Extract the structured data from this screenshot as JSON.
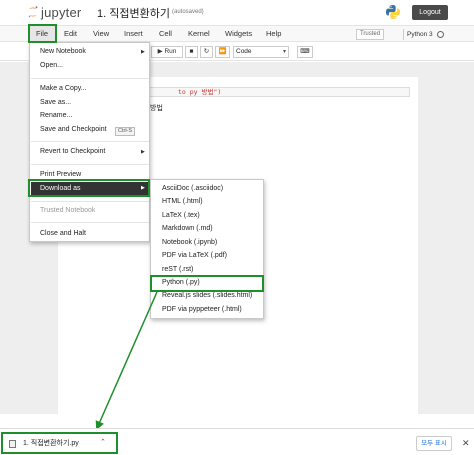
{
  "header": {
    "logo_text": "jupyter",
    "notebook_title": "1. 직접변환하기",
    "autosave_status": "(autosaved)",
    "logout_label": "Logout",
    "python_logo_icon": "python-logo-icon"
  },
  "menubar": {
    "items": [
      "File",
      "Edit",
      "View",
      "Insert",
      "Cell",
      "Kernel",
      "Widgets",
      "Help"
    ],
    "trusted": "Trusted",
    "kernel": "Python 3"
  },
  "toolbar": {
    "run_label": "Run",
    "cell_type": "Code"
  },
  "cell": {
    "input_text": "to py 방법\")",
    "output_text": "방법"
  },
  "file_menu": {
    "new_notebook": "New Notebook",
    "open": "Open...",
    "make_copy": "Make a Copy...",
    "save_as": "Save as...",
    "rename": "Rename...",
    "save_checkpoint": "Save and Checkpoint",
    "save_shortcut": "Ctrl-S",
    "revert": "Revert to Checkpoint",
    "print_preview": "Print Preview",
    "download_as": "Download as",
    "trusted_notebook": "Trusted Notebook",
    "close_halt": "Close and Halt"
  },
  "download_menu": {
    "items": [
      "AsciiDoc (.asciidoc)",
      "HTML (.html)",
      "LaTeX (.tex)",
      "Markdown (.md)",
      "Notebook (.ipynb)",
      "PDF via LaTeX (.pdf)",
      "reST (.rst)",
      "Python (.py)",
      "Reveal.js slides (.slides.html)",
      "PDF via pyppeteer (.html)"
    ],
    "highlighted_index": 7
  },
  "download_shelf": {
    "file_name": "1. 직접변환하기.py",
    "show_all": "모두 표시",
    "close_icon": "close-icon"
  },
  "colors": {
    "highlight": "#1f8f2b",
    "active_menu_bg": "#333333",
    "logo_orange": "#f37726"
  }
}
